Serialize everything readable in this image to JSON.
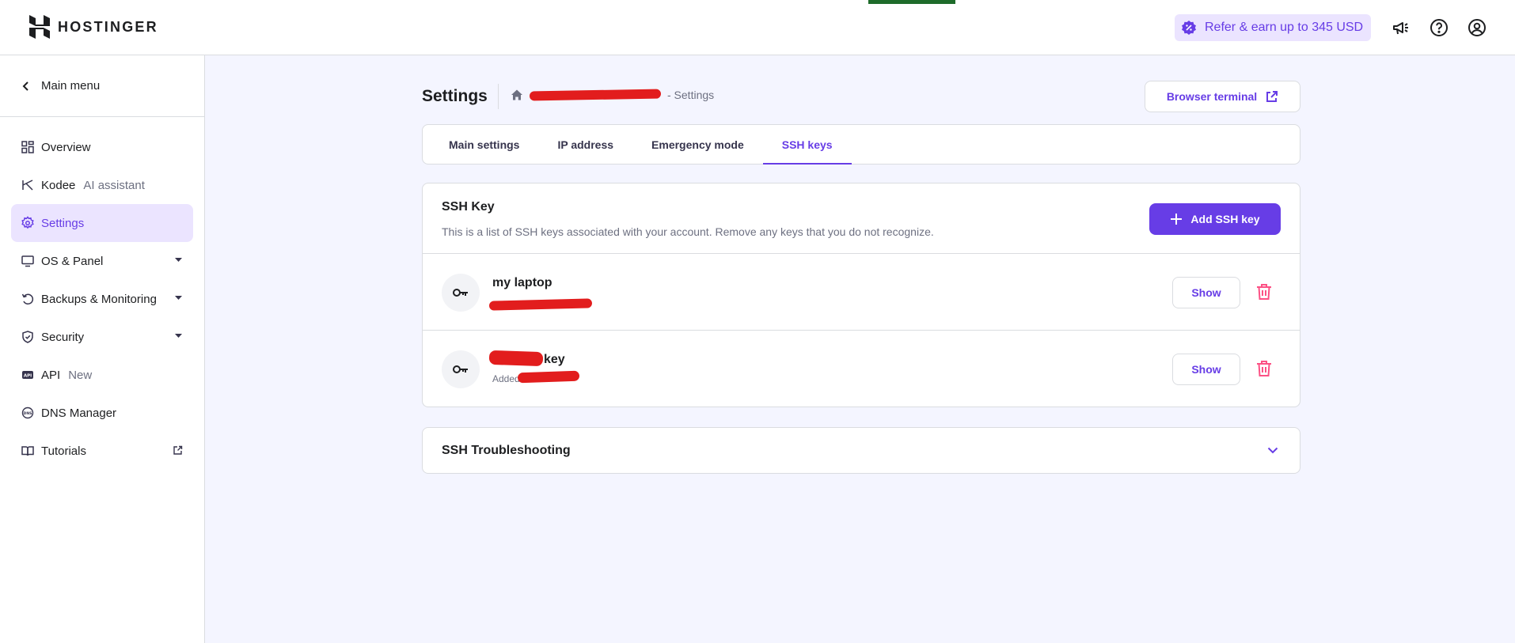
{
  "brand": {
    "name": "HOSTINGER"
  },
  "topbar": {
    "refer_label": "Refer & earn up to 345 USD"
  },
  "sidebar": {
    "main_menu": "Main menu",
    "items": [
      {
        "label": "Overview",
        "sub": "",
        "icon": "grid-icon",
        "active": false
      },
      {
        "label": "Kodee",
        "sub": "AI assistant",
        "icon": "kodee-icon",
        "active": false
      },
      {
        "label": "Settings",
        "sub": "",
        "icon": "gear-icon",
        "active": true
      },
      {
        "label": "OS & Panel",
        "sub": "",
        "icon": "monitor-icon",
        "active": false
      },
      {
        "label": "Backups & Monitoring",
        "sub": "",
        "icon": "backup-icon",
        "active": false
      },
      {
        "label": "Security",
        "sub": "",
        "icon": "shield-icon",
        "active": false
      },
      {
        "label": "API",
        "sub": "New",
        "icon": "api-icon",
        "active": false
      },
      {
        "label": "DNS Manager",
        "sub": "",
        "icon": "dns-icon",
        "active": false
      },
      {
        "label": "Tutorials",
        "sub": "",
        "icon": "book-icon",
        "active": false
      }
    ]
  },
  "header": {
    "title": "Settings",
    "breadcrumb_tail": "- Settings",
    "browser_terminal": "Browser terminal"
  },
  "tabs": [
    {
      "label": "Main settings",
      "active": false
    },
    {
      "label": "IP address",
      "active": false
    },
    {
      "label": "Emergency mode",
      "active": false
    },
    {
      "label": "SSH keys",
      "active": true
    }
  ],
  "ssh": {
    "title": "SSH Key",
    "description": "This is a list of SSH keys associated with your account. Remove any keys that you do not recognize.",
    "add_button": "Add SSH key",
    "keys": [
      {
        "name": "my laptop",
        "sub": "",
        "show_label": "Show"
      },
      {
        "name": "key",
        "sub": "Added on",
        "show_label": "Show"
      }
    ]
  },
  "troubleshooting": {
    "title": "SSH Troubleshooting"
  },
  "colors": {
    "accent": "#673de6",
    "accent_light": "#ebe4ff",
    "danger": "#fc5185",
    "redaction": "#e21d1d"
  }
}
